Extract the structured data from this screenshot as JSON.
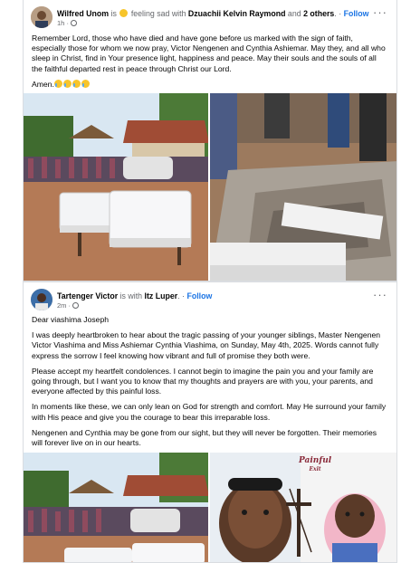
{
  "post1": {
    "author": "Wilfred Unom",
    "is_text": "is",
    "feeling": "feeling sad with",
    "tagged": "Dzuachii Kelvin Raymond",
    "and_text": "and",
    "others": "2 others",
    "follow": "Follow",
    "time": "1h",
    "paragraph": "Remember Lord, those who have died and have gone before us marked with the sign of faith, especially those for whom we now pray, Victor Nengenen and Cynthia Ashiemar. May they, and all who sleep in Christ, find in Your presence light, happiness and peace. May their souls and the souls of all the faithful departed rest in peace through Christ our Lord.",
    "amen": "Amen."
  },
  "post2": {
    "author": "Tartenger Victor",
    "is_with": "is with",
    "tagged": "Itz Luper",
    "follow": "Follow",
    "time": "2m",
    "greeting": "Dear viashima Joseph",
    "p1": "I was deeply heartbroken to hear about the tragic passing of your younger siblings, Master Nengenen Victor Viashima and Miss Ashiemar Cynthia Viashima, on Sunday, May 4th, 2025. Words cannot fully express the sorrow I feel knowing how vibrant and full of promise they both were.",
    "p2": "Please accept my heartfelt condolences. I cannot begin to imagine the pain you and your family are going through, but I want you to know that my thoughts and prayers are with you, your parents, and everyone affected by this painful loss.",
    "p3": "In moments like these, we can only lean on God for strength and comfort. May He surround your family with His peace and give you the courage to bear this irreparable loss.",
    "p4": "Nengenen and Cynthia may be gone from our sight, but they will never be forgotten. Their memories will forever live on in our hearts.",
    "photo_caption_line1": "Painful",
    "photo_caption_line2": "Exit"
  },
  "icons": {
    "feeling": "sad-face-icon",
    "crying": "crying-face-icon",
    "more": "more-options-icon",
    "audience": "globe-icon"
  },
  "colors": {
    "link": "#1b74e4",
    "muted": "#65676b",
    "text": "#050505"
  }
}
